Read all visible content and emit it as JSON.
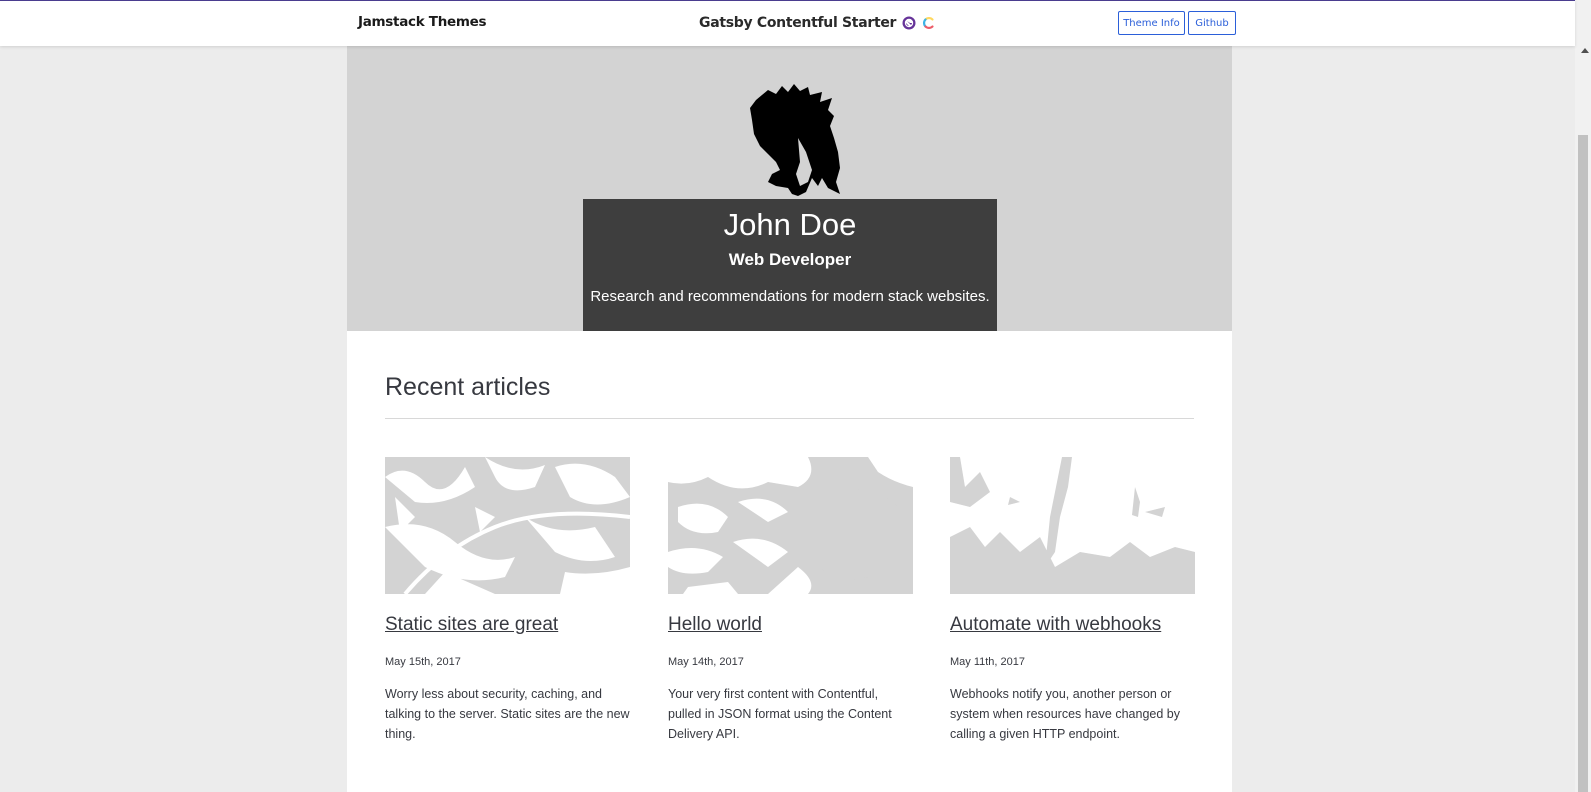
{
  "header": {
    "brand": "Jamstack Themes",
    "title": "Gatsby Contentful Starter",
    "icons": [
      "gatsby-logo-icon",
      "contentful-logo-icon"
    ],
    "buttons": {
      "theme_info": "Theme Info",
      "github": "Github"
    }
  },
  "hero": {
    "name": "John Doe",
    "title": "Web Developer",
    "description": "Research and recommendations for modern stack websites."
  },
  "articles_section": {
    "heading": "Recent articles",
    "items": [
      {
        "title": "Static sites are great",
        "date": "May 15th, 2017",
        "description": "Worry less about security, caching, and talking to the server. Static sites are the new thing."
      },
      {
        "title": "Hello world",
        "date": "May 14th, 2017",
        "description": "Your very first content with Contentful, pulled in JSON format using the Content Delivery API."
      },
      {
        "title": "Automate with webhooks",
        "date": "May 11th, 2017",
        "description": "Webhooks notify you, another person or system when resources have changed by calling a given HTTP endpoint."
      }
    ]
  },
  "colors": {
    "accent": "#2b5fd9",
    "hero_bg": "#d3d3d3",
    "hero_box": "#3e3e3e",
    "page_bg": "#ececec"
  }
}
